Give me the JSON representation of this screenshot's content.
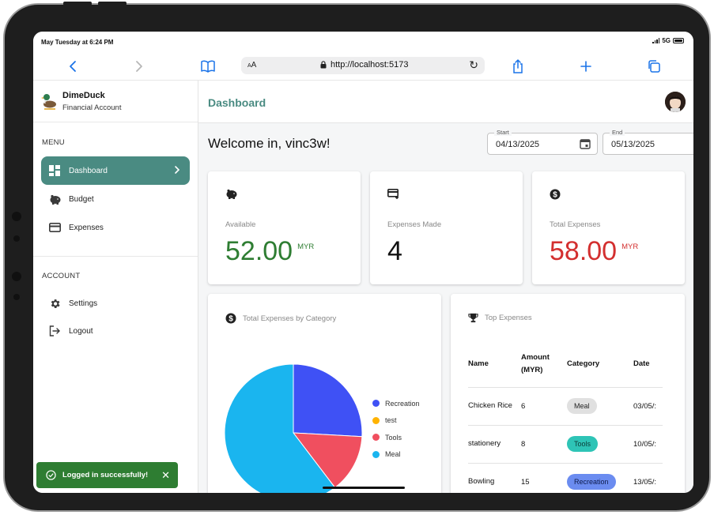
{
  "status": {
    "time": "May Tuesday at 6:24 PM",
    "network": "5G"
  },
  "browser": {
    "text_size_label": "AA",
    "url": "http://localhost:5173"
  },
  "brand": {
    "name": "DimeDuck",
    "subtitle": "Financial Account"
  },
  "menu": {
    "title": "MENU",
    "items": [
      {
        "label": "Dashboard",
        "icon": "dashboard-icon",
        "active": true
      },
      {
        "label": "Budget",
        "icon": "piggy-bank-icon",
        "active": false
      },
      {
        "label": "Expenses",
        "icon": "credit-card-icon",
        "active": false
      }
    ]
  },
  "account": {
    "title": "ACCOUNT",
    "items": [
      {
        "label": "Settings",
        "icon": "gear-icon"
      },
      {
        "label": "Logout",
        "icon": "logout-icon"
      }
    ]
  },
  "toast": {
    "message": "Logged in successfully!",
    "close": "✕"
  },
  "header": {
    "title": "Dashboard"
  },
  "welcome": "Welcome in, vinc3w!",
  "date_range": {
    "start": {
      "label": "Start",
      "value": "04/13/2025"
    },
    "end": {
      "label": "End",
      "value": "05/13/2025"
    }
  },
  "stats": [
    {
      "label": "Available",
      "value": "52.00",
      "unit": "MYR",
      "icon": "piggy-bank-icon",
      "color": "#2e7d32"
    },
    {
      "label": "Expenses Made",
      "value": "4",
      "unit": "",
      "icon": "card-add-icon",
      "color": "#111111"
    },
    {
      "label": "Total Expenses",
      "value": "58.00",
      "unit": "MYR",
      "icon": "dollar-circle-icon",
      "color": "#d32f2f"
    }
  ],
  "category_chart": {
    "title": "Total Expenses by Category",
    "chart_data": {
      "type": "pie",
      "categories": [
        "Recreation",
        "test",
        "Tools",
        "Meal"
      ],
      "values": [
        15,
        0,
        8,
        35
      ],
      "colors": [
        "#3f51f5",
        "#ffb300",
        "#f04f5f",
        "#1ab5ef"
      ]
    }
  },
  "top_expenses": {
    "title": "Top Expenses",
    "columns": [
      "Name",
      "Amount (MYR)",
      "Category",
      "Date"
    ],
    "rows": [
      {
        "name": "Chicken Rice",
        "amount": "6",
        "category": "Meal",
        "category_color": "#e0e0e0",
        "category_text": "#222222",
        "date": "03/05/:"
      },
      {
        "name": "stationery",
        "amount": "8",
        "category": "Tools",
        "category_color": "#2ec4b6",
        "category_text": "#0b3a36",
        "date": "10/05/:"
      },
      {
        "name": "Bowling",
        "amount": "15",
        "category": "Recreation",
        "category_color": "#6b8cf0",
        "category_text": "#0d1a4a",
        "date": "13/05/:"
      }
    ]
  }
}
